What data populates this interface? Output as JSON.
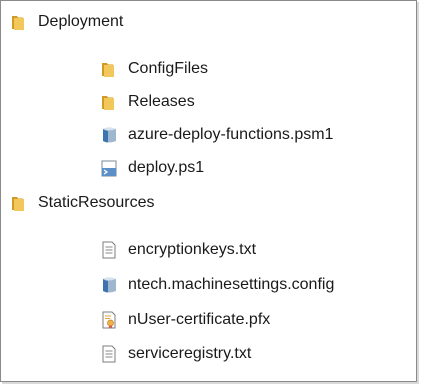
{
  "tree": {
    "root_folders": [
      {
        "label": "Deployment",
        "icon": "folder-icon",
        "children": [
          {
            "label": "ConfigFiles",
            "icon": "folder-icon"
          },
          {
            "label": "Releases",
            "icon": "folder-icon"
          },
          {
            "label": "azure-deploy-functions.psm1",
            "icon": "powershell-module-icon"
          },
          {
            "label": "deploy.ps1",
            "icon": "powershell-script-icon"
          }
        ]
      },
      {
        "label": "StaticResources",
        "icon": "folder-icon",
        "children": [
          {
            "label": "encryptionkeys.txt",
            "icon": "text-file-icon"
          },
          {
            "label": "ntech.machinesettings.config",
            "icon": "config-file-icon"
          },
          {
            "label": "nUser-certificate.pfx",
            "icon": "certificate-file-icon"
          },
          {
            "label": "serviceregistry.txt",
            "icon": "text-file-icon"
          }
        ]
      }
    ]
  },
  "colors": {
    "folder": "#e8b84a",
    "folder_dark": "#d19a22",
    "text": "#1a1a1a",
    "border": "#8a8a8a"
  }
}
